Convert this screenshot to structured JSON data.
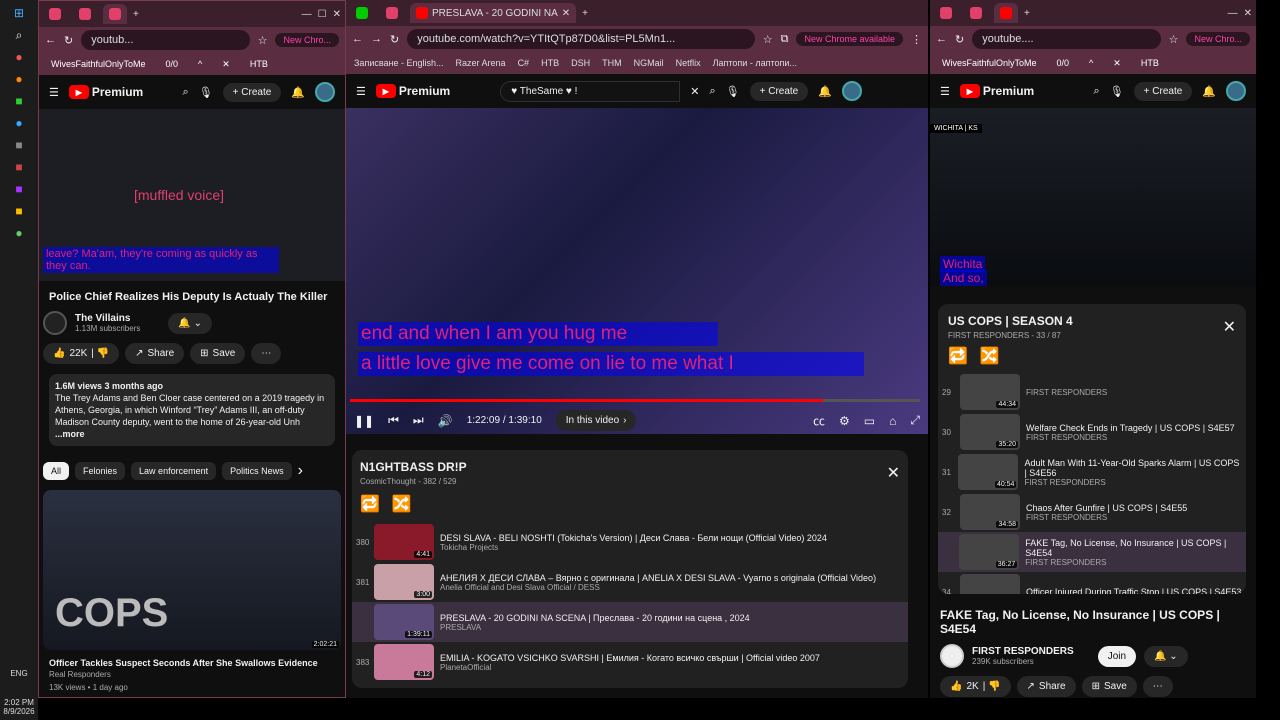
{
  "taskbar": {
    "lang": "ENG",
    "time": "2:02 PM",
    "date": "8/9/2026"
  },
  "left": {
    "addr_url": "youtub...",
    "new_chrome": "New Chro...",
    "find_text": "WivesFaithfulOnlyToMe",
    "find_count": "0/0",
    "bookmark": "HTB",
    "logo": "Premium",
    "create": "Create",
    "video_caption1": "[muffled voice]",
    "video_caption2": "leave? Ma'am, they're coming as quickly as they can.",
    "video_title": "Police Chief Realizes His Deputy Is Actualy The Killer",
    "channel": "The Villains",
    "subs": "1.13M subscribers",
    "likes": "22K",
    "share": "Share",
    "save": "Save",
    "views": "1.6M views  3 months ago",
    "description": "The Trey Adams and Ben Cloer case centered on a 2019 tragedy in Athens, Georgia, in which Winford “Trey” Adams III, an off-duty Madison County deputy, went to the home of 26-year-old Unh",
    "more": "...more",
    "chips": [
      "All",
      "Felonies",
      "Law enforcement",
      "Politics News"
    ],
    "rec_title": "Officer Tackles Suspect Seconds After She Swallows Evidence",
    "rec_channel": "Real Responders",
    "rec_meta": "13K views • 1 day ago",
    "rec_duration": "2:02:21",
    "rec_thumb_text": "COPS"
  },
  "mid": {
    "tab_title": "PRESLAVA - 20 GODINI NA",
    "url": "youtube.com/watch?v=YTItQTp87D0&list=PL5Mn1...",
    "new_chrome": "New Chrome available",
    "bookmarks": [
      "Записване - English...",
      "Razer Arena",
      "C#",
      "HTB",
      "DSH",
      "THM",
      "NGMail",
      "Netflix",
      "Лаптопи - лаптопи..."
    ],
    "logo": "Premium",
    "search_value": "TheSame",
    "create": "Create",
    "lyric1": "end and when I am you hug me",
    "lyric2": "a little love give me come on lie to me what I",
    "time": "1:22:09 / 1:39:10",
    "in_video": "In this video",
    "playlist_title": "N1GHTBASS DR!P",
    "playlist_meta": "CosmicThought - 382 / 529",
    "items": [
      {
        "num": "380",
        "title": "DESI SLAVA - BELI NOSHTI (Tokicha's Version) | Деси Слава - Бели нощи (Official Video) 2024",
        "channel": "Tokicha Projects",
        "dur": "4:41",
        "color": "#8a1a2a"
      },
      {
        "num": "381",
        "title": "АНЕЛИЯ Х ДЕСИ СЛАВА – Вярно с оригинала | ANELIA X DESI SLAVA - Vyarno s originala (Official Video)",
        "channel": "Anelia Official and Desi Slava Official / DESS",
        "dur": "3:00",
        "color": "#c9a0a8"
      },
      {
        "num": "",
        "title": "PRESLAVA - 20 GODINI NA SCENA | Преслава - 20 години на сцена , 2024",
        "channel": "PRESLAVA",
        "dur": "1:39:11",
        "color": "#5a4a7a"
      },
      {
        "num": "383",
        "title": "EMILIA - KOGATO VSICHKO SVARSHI | Емилия - Когато всичко свърши | Official video 2007",
        "channel": "PlanetaOfficial",
        "dur": "4:12",
        "color": "#c97a9a"
      }
    ]
  },
  "right": {
    "addr_url": "youtube....",
    "new_chrome": "New Chro...",
    "find_text": "WivesFaithfulOnlyToMe",
    "find_count": "0/0",
    "bookmark": "HTB",
    "logo": "Premium",
    "create": "Create",
    "video_label": "WICHITA | KS",
    "caption1": "Wichita",
    "caption2": "And so,",
    "playlist_title": "US COPS | SEASON 4",
    "playlist_meta": "FIRST RESPONDERS - 33 / 87",
    "items": [
      {
        "num": "29",
        "title": "",
        "channel": "FIRST RESPONDERS",
        "dur": "44:34"
      },
      {
        "num": "30",
        "title": "Welfare Check Ends in Tragedy | US COPS | S4E57",
        "channel": "FIRST RESPONDERS",
        "dur": "35:20"
      },
      {
        "num": "31",
        "title": "Adult Man With 11-Year-Old Sparks Alarm | US COPS | S4E56",
        "channel": "FIRST RESPONDERS",
        "dur": "40:54"
      },
      {
        "num": "32",
        "title": "Chaos After Gunfire | US COPS | S4E55",
        "channel": "FIRST RESPONDERS",
        "dur": "34:58"
      },
      {
        "num": "",
        "title": "FAKE Tag, No License, No Insurance | US COPS | S4E54",
        "channel": "FIRST RESPONDERS",
        "dur": "36:27"
      },
      {
        "num": "34",
        "title": "Officer Injured During Traffic Stop | US COPS | S4E53",
        "channel": "",
        "dur": ""
      }
    ],
    "video_title": "FAKE Tag, No License, No Insurance | US COPS | S4E54",
    "channel": "FIRST RESPONDERS",
    "subs": "239K subscribers",
    "join": "Join",
    "likes": "2K",
    "share": "Share",
    "save": "Save"
  }
}
